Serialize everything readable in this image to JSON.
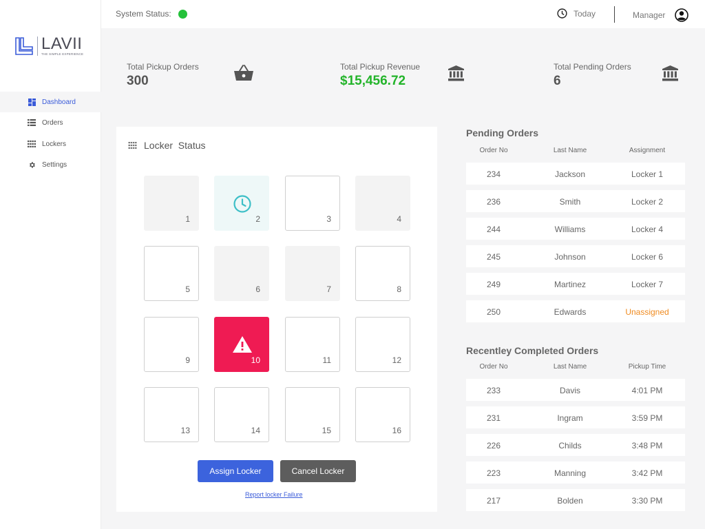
{
  "topbar": {
    "system_status_label": "System Status:",
    "system_status_color": "#24c13a",
    "today_label": "Today",
    "user_label": "Manager"
  },
  "brand": {
    "name": "LAVII",
    "tagline": "THE SIMPLE EXPERIENCE",
    "icon": "lavii-logo-icon"
  },
  "nav": {
    "items": [
      {
        "label": "Dashboard",
        "icon": "dashboard-icon",
        "active": true
      },
      {
        "label": "Orders",
        "icon": "list-icon",
        "active": false
      },
      {
        "label": "Lockers",
        "icon": "grid-icon",
        "active": false
      },
      {
        "label": "Settings",
        "icon": "gear-icon",
        "active": false
      }
    ]
  },
  "stats": {
    "pickup_orders": {
      "label": "Total Pickup Orders",
      "value": "300",
      "icon": "basket-icon"
    },
    "pickup_revenue": {
      "label": "Total Pickup Revenue",
      "value": "$15,456.72",
      "icon": "bank-icon"
    },
    "pending_orders": {
      "label": "Total Pending Orders",
      "value": "6",
      "icon": "bank-icon"
    }
  },
  "locker_status": {
    "title": "Locker  Status",
    "lockers": [
      {
        "num": "1",
        "state": "filled"
      },
      {
        "num": "2",
        "state": "pending"
      },
      {
        "num": "3",
        "state": "empty"
      },
      {
        "num": "4",
        "state": "filled"
      },
      {
        "num": "5",
        "state": "empty"
      },
      {
        "num": "6",
        "state": "filled"
      },
      {
        "num": "7",
        "state": "filled"
      },
      {
        "num": "8",
        "state": "empty"
      },
      {
        "num": "9",
        "state": "empty"
      },
      {
        "num": "10",
        "state": "failure"
      },
      {
        "num": "11",
        "state": "empty"
      },
      {
        "num": "12",
        "state": "empty"
      },
      {
        "num": "13",
        "state": "empty"
      },
      {
        "num": "14",
        "state": "empty"
      },
      {
        "num": "15",
        "state": "empty"
      },
      {
        "num": "16",
        "state": "empty"
      }
    ],
    "assign_label": "Assign Locker",
    "cancel_label": "Cancel Locker",
    "report_label": "Report locker Failure",
    "colors": {
      "failure": "#ef1b53",
      "pending_icon": "#3dbfc7",
      "assign": "#3c63dd",
      "cancel": "#5d5d5d"
    }
  },
  "pending_orders": {
    "title": "Pending Orders",
    "columns": [
      "Order No",
      "Last Name",
      "Assignment"
    ],
    "rows": [
      [
        "234",
        "Jackson",
        "Locker 1"
      ],
      [
        "236",
        "Smith",
        "Locker 2"
      ],
      [
        "244",
        "Williams",
        "Locker 4"
      ],
      [
        "245",
        "Johnson",
        "Locker 6"
      ],
      [
        "249",
        "Martinez",
        "Locker 7"
      ],
      [
        "250",
        "Edwards",
        "Unassigned"
      ]
    ]
  },
  "completed_orders": {
    "title": "Recentley Completed Orders",
    "columns": [
      "Order No",
      "Last Name",
      "Pickup Time"
    ],
    "rows": [
      [
        "233",
        "Davis",
        "4:01 PM"
      ],
      [
        "231",
        "Ingram",
        "3:59 PM"
      ],
      [
        "226",
        "Childs",
        "3:48 PM"
      ],
      [
        "223",
        "Manning",
        "3:42 PM"
      ],
      [
        "217",
        "Bolden",
        "3:30 PM"
      ]
    ]
  }
}
